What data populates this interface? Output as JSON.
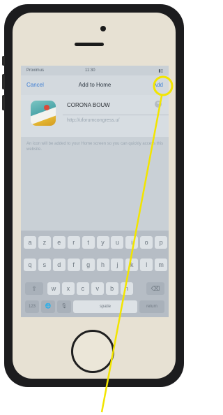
{
  "status_bar": {
    "carrier": "Proximus",
    "time": "11:30",
    "battery": ""
  },
  "nav": {
    "cancel": "Cancel",
    "title": "Add to Home",
    "add": "Add"
  },
  "form": {
    "app_name": "CORONA BOUW",
    "url": "http://uforumcongress.u/"
  },
  "info": {
    "text": "An icon will be added to your Home screen so you can quickly access this website."
  },
  "keyboard": {
    "row1": [
      "a",
      "z",
      "e",
      "r",
      "t",
      "y",
      "u",
      "i",
      "o",
      "p"
    ],
    "row2": [
      "q",
      "s",
      "d",
      "f",
      "g",
      "h",
      "j",
      "k",
      "l",
      "m"
    ],
    "row3": [
      "w",
      "x",
      "c",
      "v",
      "b",
      "n"
    ],
    "shift": "⇧",
    "backspace": "⌫",
    "numbers": "123",
    "globe": "🌐",
    "mic": "🎙",
    "space": "spatie",
    "return": "return"
  },
  "annotation": {
    "color": "#f2e500"
  }
}
